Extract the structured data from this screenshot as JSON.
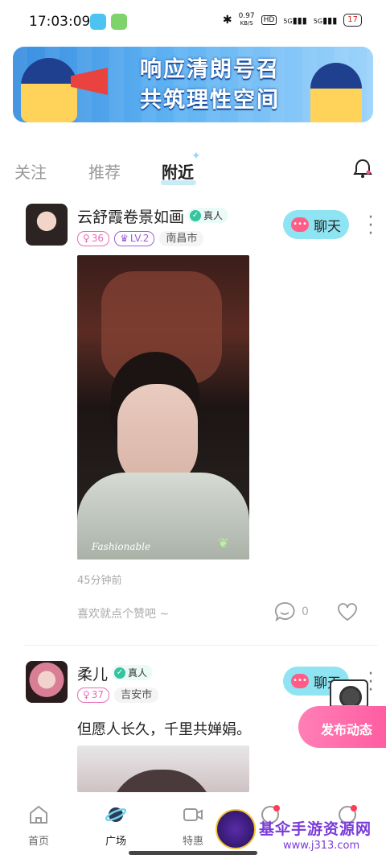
{
  "status_bar": {
    "time": "17:03:09",
    "speed": "0.97",
    "speed_unit": "KB/S",
    "hd": "HD",
    "signal1": "5G",
    "signal2": "5G",
    "battery": "17"
  },
  "banner": {
    "line1": "响应清朗号召",
    "line2": "共筑理性空间"
  },
  "tabs": [
    {
      "label": "关注"
    },
    {
      "label": "推荐"
    },
    {
      "label": "附近"
    }
  ],
  "posts": [
    {
      "name": "云舒霞卷景如画",
      "verified": "真人",
      "age": "36",
      "level": "LV.2",
      "city": "南昌市",
      "chat": "聊天",
      "photo_caption": "Fashionable",
      "time_ago": "45分钟前",
      "like_prompt": "喜欢就点个赞吧 ~",
      "comments": "0"
    },
    {
      "name": "柔儿",
      "verified": "真人",
      "age": "37",
      "city": "吉安市",
      "chat": "聊天",
      "text": "但愿人长久，千里共婵娟。"
    }
  ],
  "fab": {
    "label": "发布动态"
  },
  "nav": [
    {
      "label": "首页"
    },
    {
      "label": "广场"
    },
    {
      "label": "特惠"
    },
    {
      "label": ""
    },
    {
      "label": ""
    }
  ],
  "watermark": {
    "title": "基伞手游资源网",
    "url": "www.j313.com"
  }
}
